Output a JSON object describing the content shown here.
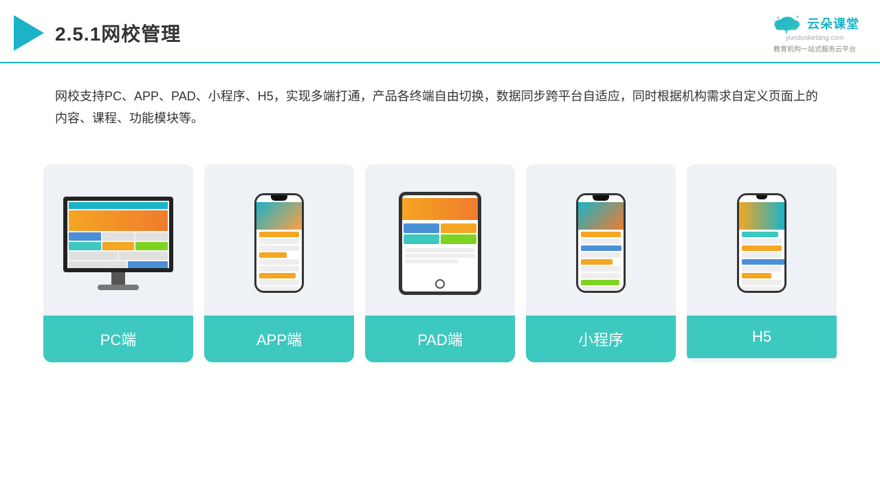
{
  "header": {
    "title": "2.5.1网校管理",
    "brand_name": "云朵课堂",
    "brand_url": "yunduoketang.com",
    "brand_tagline": "教育机构一站\n式服务云平台"
  },
  "description": {
    "text": "网校支持PC、APP、PAD、小程序、H5，实现多端打通，产品各终端自由切换，数据同步跨平台自适应，同时根据机构需求自定义页面上的内容、课程、功能模块等。"
  },
  "cards": [
    {
      "id": "pc",
      "label": "PC端"
    },
    {
      "id": "app",
      "label": "APP端"
    },
    {
      "id": "pad",
      "label": "PAD端"
    },
    {
      "id": "miniprogram",
      "label": "小程序"
    },
    {
      "id": "h5",
      "label": "H5"
    }
  ],
  "accent_color": "#3dc8c0",
  "border_color": "#1ab3c8"
}
